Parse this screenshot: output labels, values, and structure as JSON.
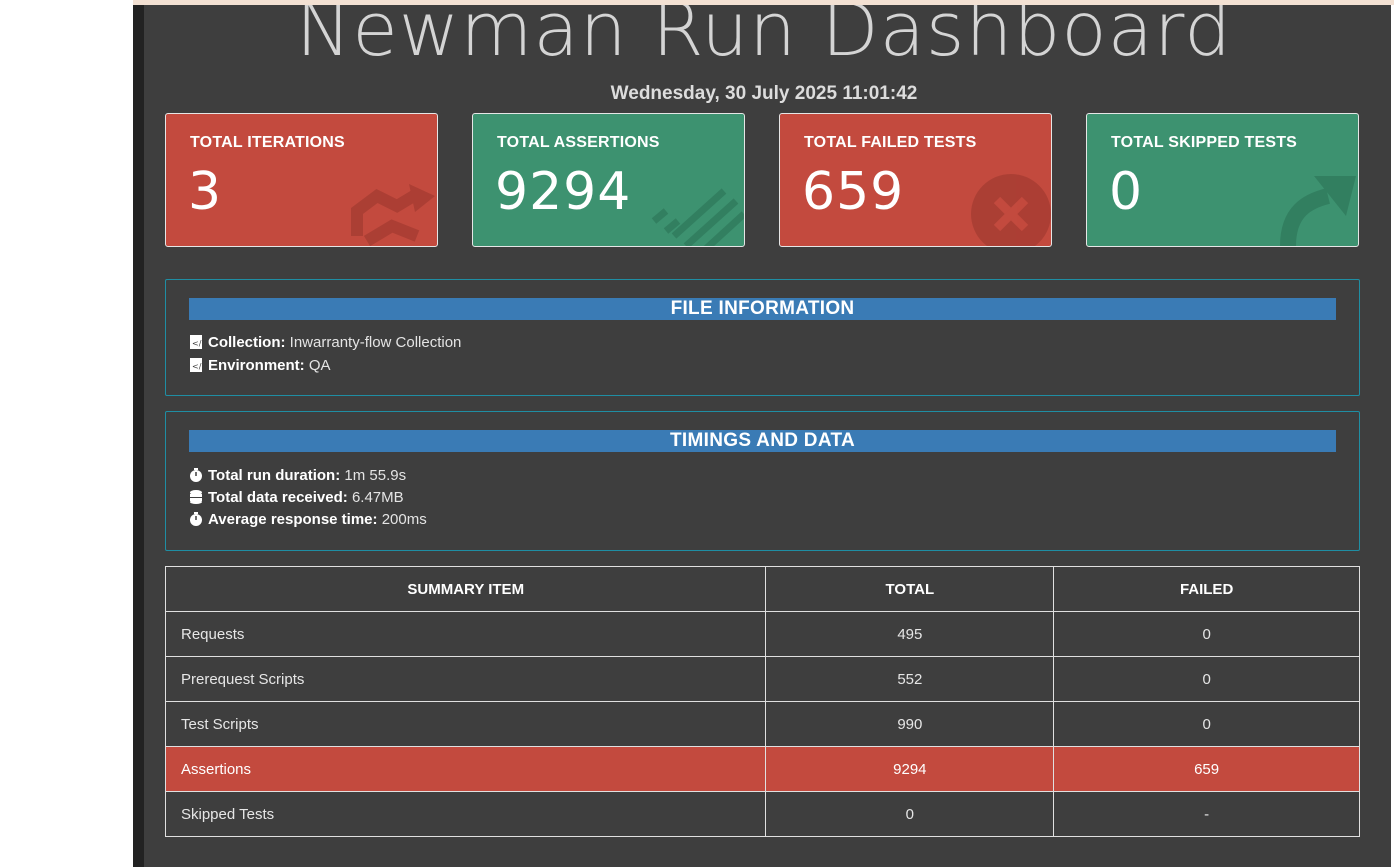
{
  "header": {
    "title": "Newman Run Dashboard",
    "datetime": "Wednesday, 30 July 2025 11:01:42"
  },
  "cards": [
    {
      "label": "TOTAL ITERATIONS",
      "value": "3",
      "color": "#c34a3e",
      "icon": "refresh-icon"
    },
    {
      "label": "TOTAL ASSERTIONS",
      "value": "9294",
      "color": "#3d9270",
      "icon": "list-icon"
    },
    {
      "label": "TOTAL FAILED TESTS",
      "value": "659",
      "color": "#c34a3e",
      "icon": "times-circle-icon"
    },
    {
      "label": "TOTAL SKIPPED TESTS",
      "value": "0",
      "color": "#3d9270",
      "icon": "share-arrow-icon"
    }
  ],
  "file_info": {
    "header": "FILE INFORMATION",
    "collection_label": "Collection:",
    "collection_value": "Inwarranty-flow Collection",
    "environment_label": "Environment:",
    "environment_value": "QA"
  },
  "timings": {
    "header": "TIMINGS AND DATA",
    "duration_label": "Total run duration:",
    "duration_value": "1m 55.9s",
    "data_label": "Total data received:",
    "data_value": "6.47MB",
    "avg_label": "Average response time:",
    "avg_value": "200ms"
  },
  "summary": {
    "columns": [
      "SUMMARY ITEM",
      "TOTAL",
      "FAILED"
    ],
    "rows": [
      {
        "item": "Requests",
        "total": "495",
        "failed": "0",
        "highlight": false
      },
      {
        "item": "Prerequest Scripts",
        "total": "552",
        "failed": "0",
        "highlight": false
      },
      {
        "item": "Test Scripts",
        "total": "990",
        "failed": "0",
        "highlight": false
      },
      {
        "item": "Assertions",
        "total": "9294",
        "failed": "659",
        "highlight": true
      },
      {
        "item": "Skipped Tests",
        "total": "0",
        "failed": "-",
        "highlight": false
      }
    ]
  },
  "colors": {
    "danger": "#c34a3e",
    "success": "#3d9270",
    "info_header": "#3a7bb5",
    "panel_border": "#1f8ea3",
    "background": "#3e3e3e"
  }
}
